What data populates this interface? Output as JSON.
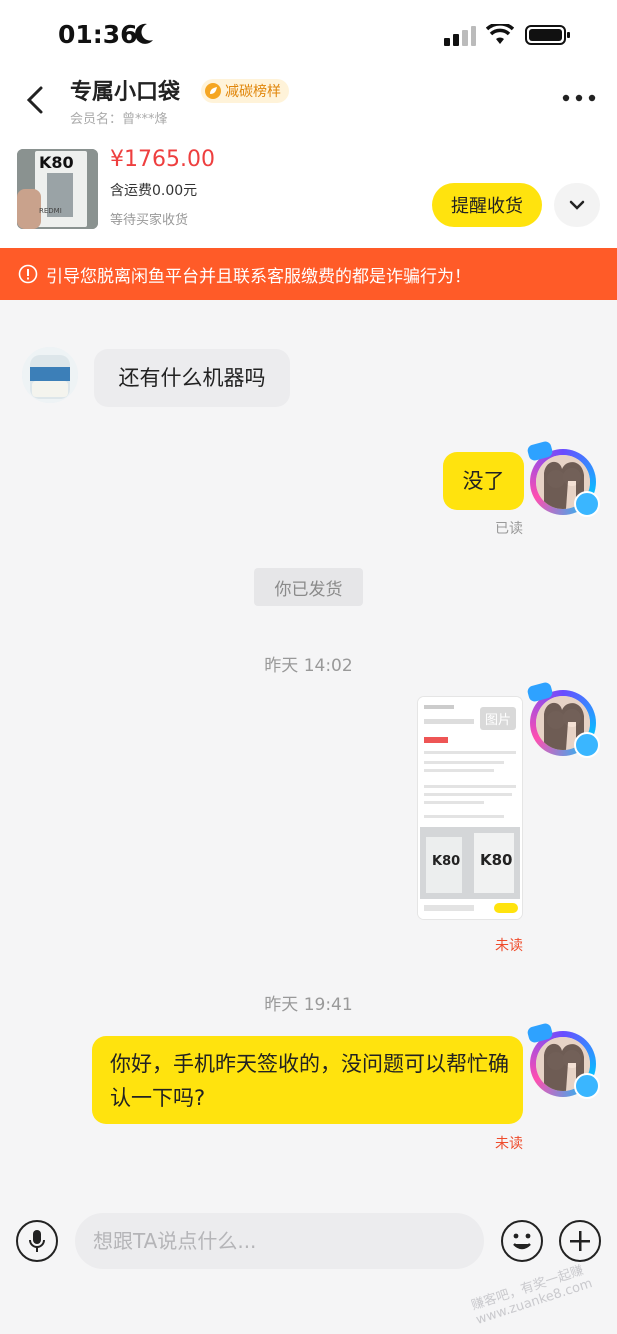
{
  "status_bar": {
    "time": "01:36"
  },
  "header": {
    "title": "专属小口袋",
    "badge": "减碳榜样",
    "member": "会员名：曾***烽"
  },
  "order": {
    "thumb_text": "K80",
    "thumb_brand": "REDMI",
    "price": "¥1765.00",
    "shipping": "含运费0.00元",
    "status": "等待买家收货",
    "remind_button": "提醒收货"
  },
  "warning": "引导您脱离闲鱼平台并且联系客服缴费的都是诈骗行为！",
  "messages": {
    "m1": "还有什么机器吗",
    "m2": "没了",
    "m2_status": "已读",
    "system": "你已发货",
    "time1": "昨天 14:02",
    "image_label": "图片",
    "image_status": "未读",
    "time2": "昨天 19:41",
    "m3": "你好，手机昨天签收的，没问题可以帮忙确认一下吗?",
    "m3_status": "未读"
  },
  "input": {
    "placeholder": "想跟TA说点什么..."
  },
  "watermark": "赚客吧，有奖一起赚 www.zuanke8.com",
  "colors": {
    "accent": "#ffe30e",
    "warning": "#ff5b28",
    "price": "#ee3f3f"
  }
}
